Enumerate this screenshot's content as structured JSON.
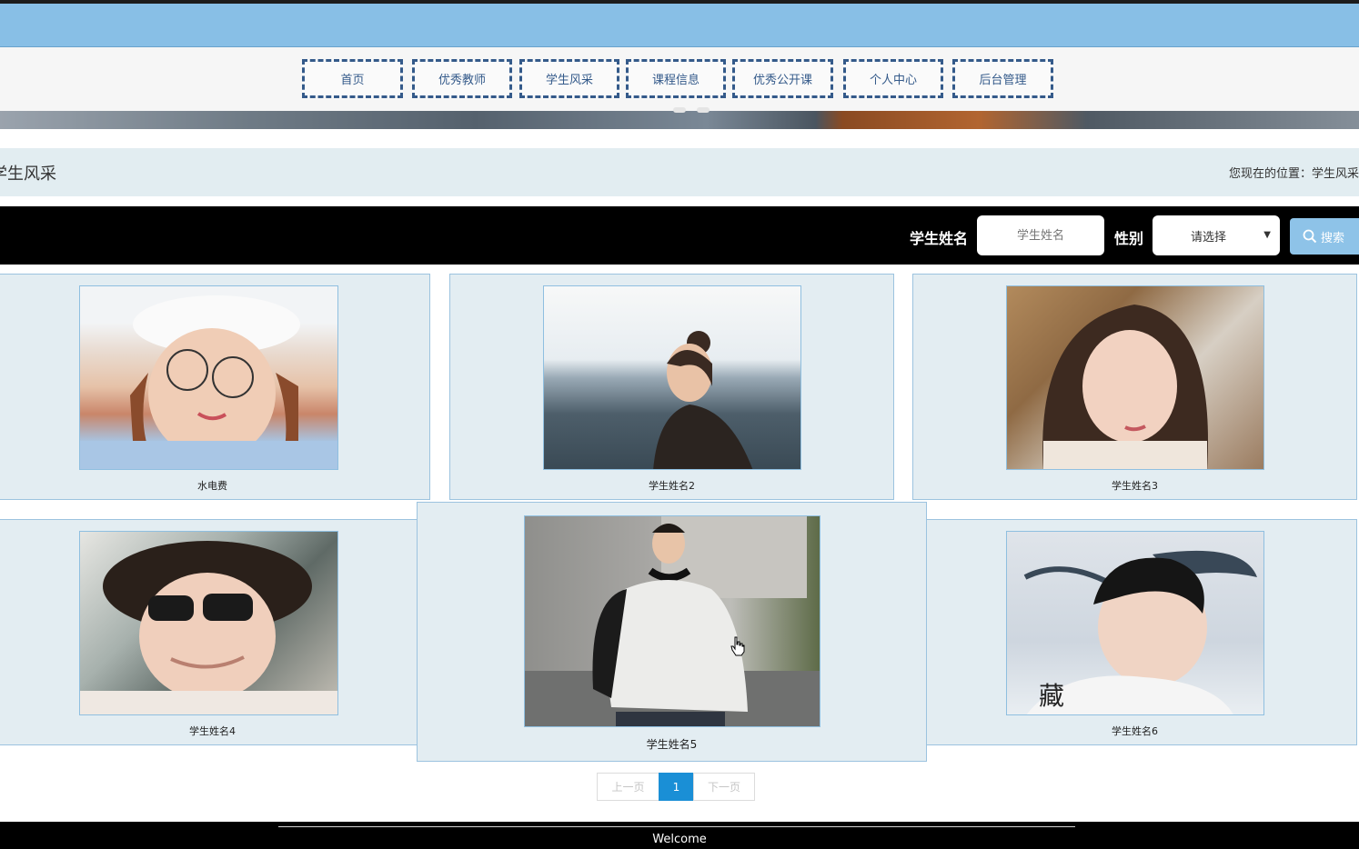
{
  "nav": {
    "items": [
      {
        "label": "首页"
      },
      {
        "label": "优秀教师"
      },
      {
        "label": "学生风采"
      },
      {
        "label": "课程信息"
      },
      {
        "label": "优秀公开课"
      },
      {
        "label": "个人中心"
      },
      {
        "label": "后台管理"
      }
    ]
  },
  "page": {
    "title": "学生风采",
    "breadcrumb": "您现在的位置：学生风采"
  },
  "search": {
    "name_label": "学生姓名",
    "name_placeholder": "学生姓名",
    "gender_label": "性别",
    "gender_selected": "请选择",
    "button_label": "搜索"
  },
  "students": [
    {
      "name": "水电费"
    },
    {
      "name": "学生姓名2"
    },
    {
      "name": "学生姓名3"
    },
    {
      "name": "学生姓名4"
    },
    {
      "name": "学生姓名5"
    },
    {
      "name": "学生姓名6"
    }
  ],
  "pagination": {
    "prev_label": "上一页",
    "current_page": "1",
    "next_label": "下一页"
  },
  "footer": {
    "text": "Welcome"
  },
  "colors": {
    "topbar": "#88bfe6",
    "nav_border": "#345a8a",
    "card_bg": "#e3edf2",
    "active_page": "#1a8fd6"
  }
}
